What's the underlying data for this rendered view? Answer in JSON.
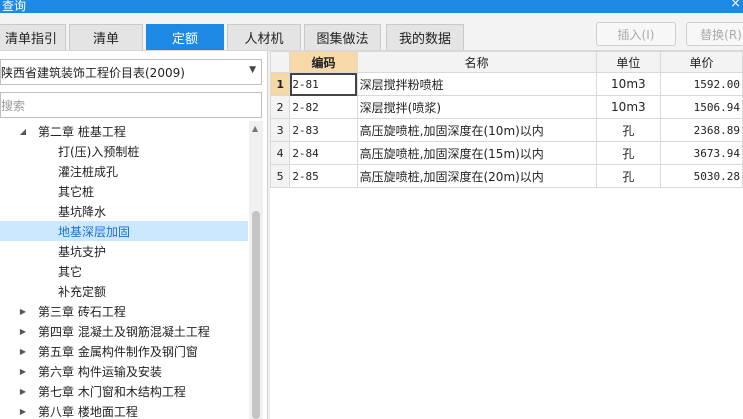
{
  "window": {
    "title": "查询",
    "close": "×"
  },
  "tabs": [
    {
      "label": "清单指引"
    },
    {
      "label": "清单"
    },
    {
      "label": "定额"
    },
    {
      "label": "人材机"
    },
    {
      "label": "图集做法"
    },
    {
      "label": "我的数据"
    }
  ],
  "toolbar": {
    "insert_label": "插入(I)",
    "replace_label": "替换(R)"
  },
  "left": {
    "library": "陕西省建筑装饰工程价目表(2009)",
    "search_placeholder": "搜索",
    "tree": [
      {
        "label": "第二章 桩基工程",
        "expanded": true
      },
      {
        "label": "打(压)入预制桩"
      },
      {
        "label": "灌注桩成孔"
      },
      {
        "label": "其它桩"
      },
      {
        "label": "基坑降水"
      },
      {
        "label": "地基深层加固",
        "selected": true
      },
      {
        "label": "基坑支护"
      },
      {
        "label": "其它"
      },
      {
        "label": "补充定额"
      },
      {
        "label": "第三章 砖石工程"
      },
      {
        "label": "第四章 混凝土及钢筋混凝土工程"
      },
      {
        "label": "第五章 金属构件制作及钢门窗"
      },
      {
        "label": "第六章 构件运输及安装"
      },
      {
        "label": "第七章 木门窗和木结构工程"
      },
      {
        "label": "第八章 楼地面工程"
      }
    ]
  },
  "grid": {
    "headers": {
      "code": "编码",
      "name": "名称",
      "unit": "单位",
      "price": "单价"
    },
    "rows": [
      {
        "idx": "1",
        "code": "2-81",
        "name": "深层搅拌粉喷桩",
        "unit": "10m3",
        "price": "1592.00"
      },
      {
        "idx": "2",
        "code": "2-82",
        "name": "深层搅拌(喷浆)",
        "unit": "10m3",
        "price": "1506.94"
      },
      {
        "idx": "3",
        "code": "2-83",
        "name": "高压旋喷桩,加固深度在(10m)以内",
        "unit": "孔",
        "price": "2368.89"
      },
      {
        "idx": "4",
        "code": "2-84",
        "name": "高压旋喷桩,加固深度在(15m)以内",
        "unit": "孔",
        "price": "3673.94"
      },
      {
        "idx": "5",
        "code": "2-85",
        "name": "高压旋喷桩,加固深度在(20m)以内",
        "unit": "孔",
        "price": "5030.28"
      }
    ]
  }
}
